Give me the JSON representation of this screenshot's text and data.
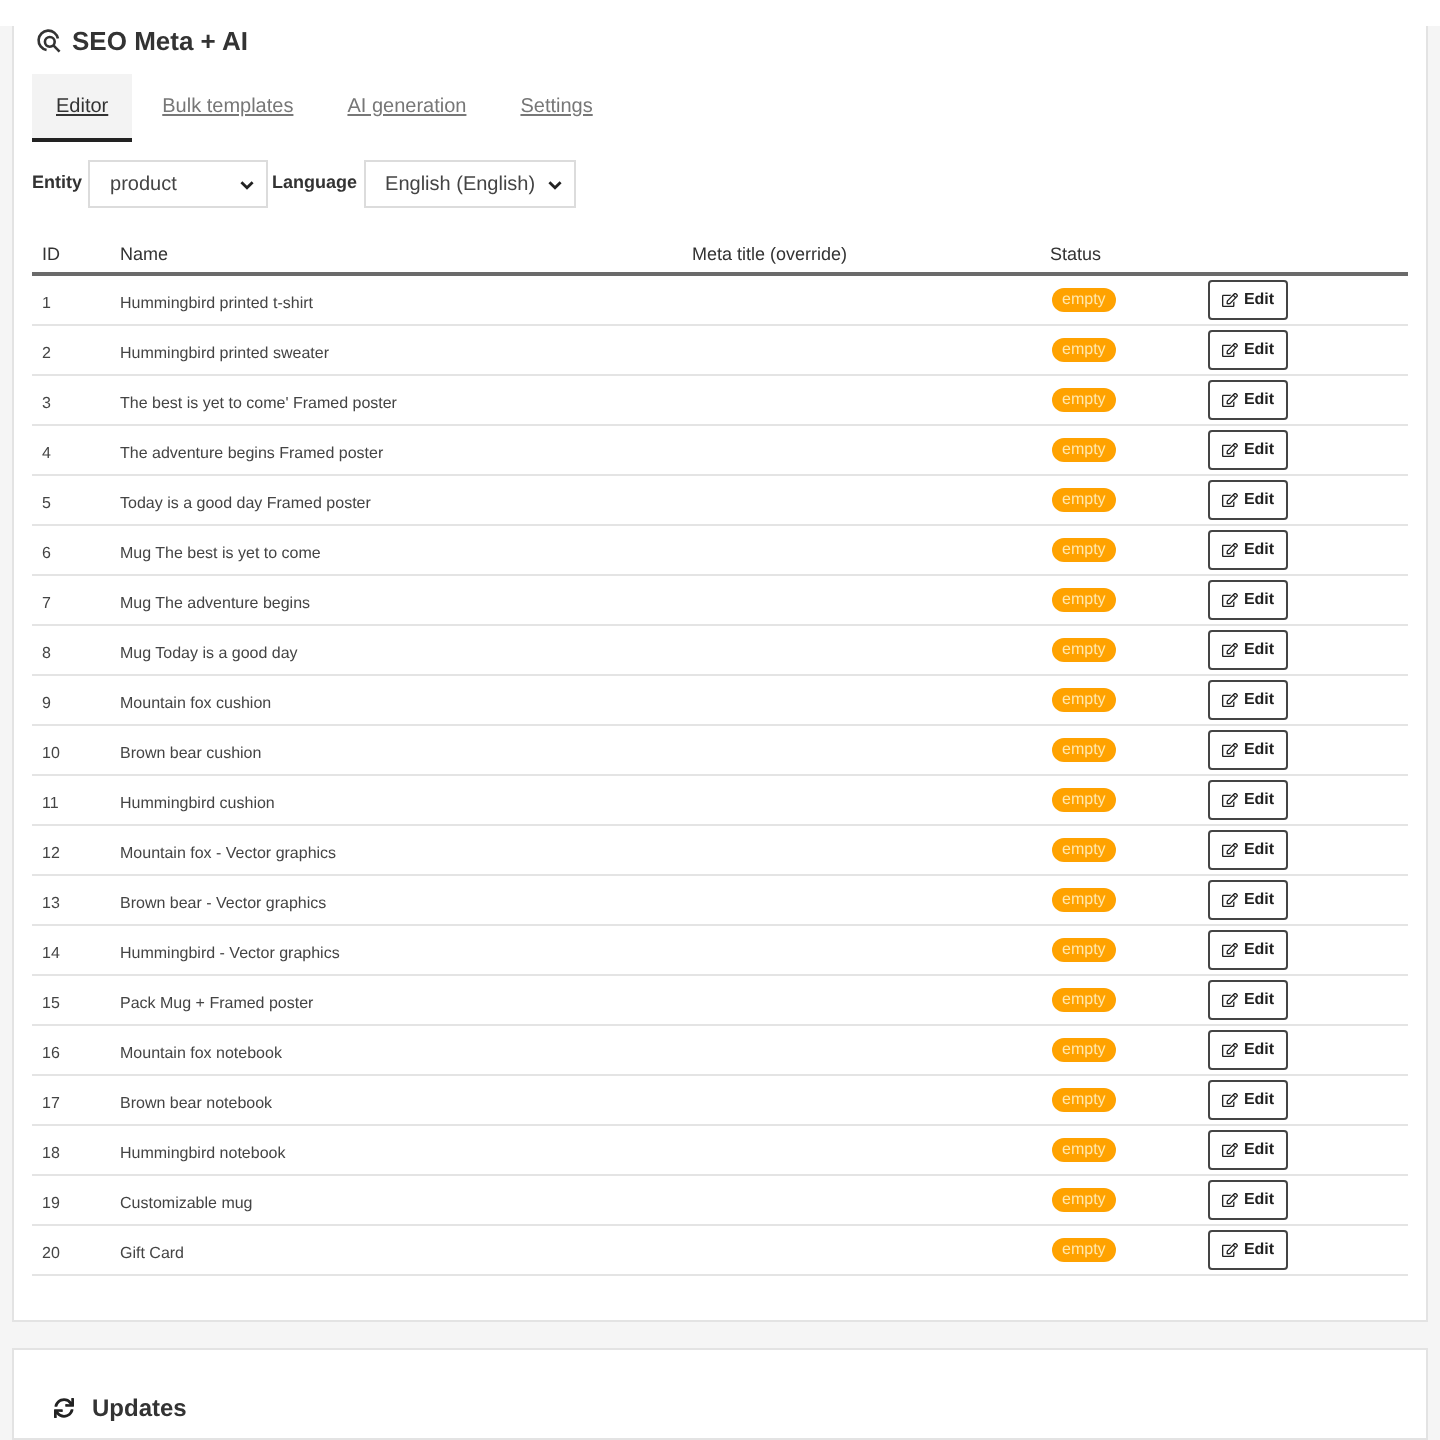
{
  "header": {
    "title": "SEO Meta + AI"
  },
  "tabs": [
    {
      "label": "Editor",
      "selected": true
    },
    {
      "label": "Bulk templates",
      "selected": false
    },
    {
      "label": "AI generation",
      "selected": false
    },
    {
      "label": "Settings",
      "selected": false
    }
  ],
  "filters": [
    {
      "label": "Entity",
      "value": "product"
    },
    {
      "label": "Language",
      "value": "English (English)"
    }
  ],
  "table": {
    "columns": [
      "ID",
      "Name",
      "Meta title (override)",
      "Status"
    ],
    "rows": [
      {
        "id": "1",
        "name": "Hummingbird printed t-shirt",
        "status": "empty",
        "action": "Edit"
      },
      {
        "id": "2",
        "name": "Hummingbird printed sweater",
        "status": "empty",
        "action": "Edit"
      },
      {
        "id": "3",
        "name": "The best is yet to come' Framed poster",
        "status": "empty",
        "action": "Edit"
      },
      {
        "id": "4",
        "name": "The adventure begins Framed poster",
        "status": "empty",
        "action": "Edit"
      },
      {
        "id": "5",
        "name": "Today is a good day Framed poster",
        "status": "empty",
        "action": "Edit"
      },
      {
        "id": "6",
        "name": "Mug The best is yet to come",
        "status": "empty",
        "action": "Edit"
      },
      {
        "id": "7",
        "name": "Mug The adventure begins",
        "status": "empty",
        "action": "Edit"
      },
      {
        "id": "8",
        "name": "Mug Today is a good day",
        "status": "empty",
        "action": "Edit"
      },
      {
        "id": "9",
        "name": "Mountain fox cushion",
        "status": "empty",
        "action": "Edit"
      },
      {
        "id": "10",
        "name": "Brown bear cushion",
        "status": "empty",
        "action": "Edit"
      },
      {
        "id": "11",
        "name": "Hummingbird cushion",
        "status": "empty",
        "action": "Edit"
      },
      {
        "id": "12",
        "name": "Mountain fox - Vector graphics",
        "status": "empty",
        "action": "Edit"
      },
      {
        "id": "13",
        "name": "Brown bear - Vector graphics",
        "status": "empty",
        "action": "Edit"
      },
      {
        "id": "14",
        "name": "Hummingbird - Vector graphics",
        "status": "empty",
        "action": "Edit"
      },
      {
        "id": "15",
        "name": "Pack Mug + Framed poster",
        "status": "empty",
        "action": "Edit"
      },
      {
        "id": "16",
        "name": "Mountain fox notebook",
        "status": "empty",
        "action": "Edit"
      },
      {
        "id": "17",
        "name": "Brown bear notebook",
        "status": "empty",
        "action": "Edit"
      },
      {
        "id": "18",
        "name": "Hummingbird notebook",
        "status": "empty",
        "action": "Edit"
      },
      {
        "id": "19",
        "name": "Customizable mug",
        "status": "empty",
        "action": "Edit"
      },
      {
        "id": "20",
        "name": "Gift Card",
        "status": "empty",
        "action": "Edit"
      }
    ]
  },
  "updates": {
    "title": "Updates"
  }
}
